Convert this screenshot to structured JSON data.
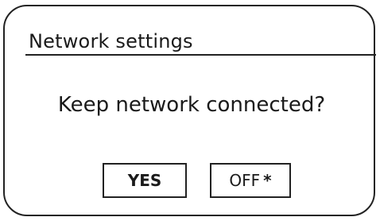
{
  "dialog": {
    "title": "Network settings",
    "question": "Keep network connected?",
    "options": [
      {
        "label": "YES",
        "highlighted": true
      },
      {
        "label": "OFF",
        "marker": "*",
        "current": true
      }
    ]
  }
}
